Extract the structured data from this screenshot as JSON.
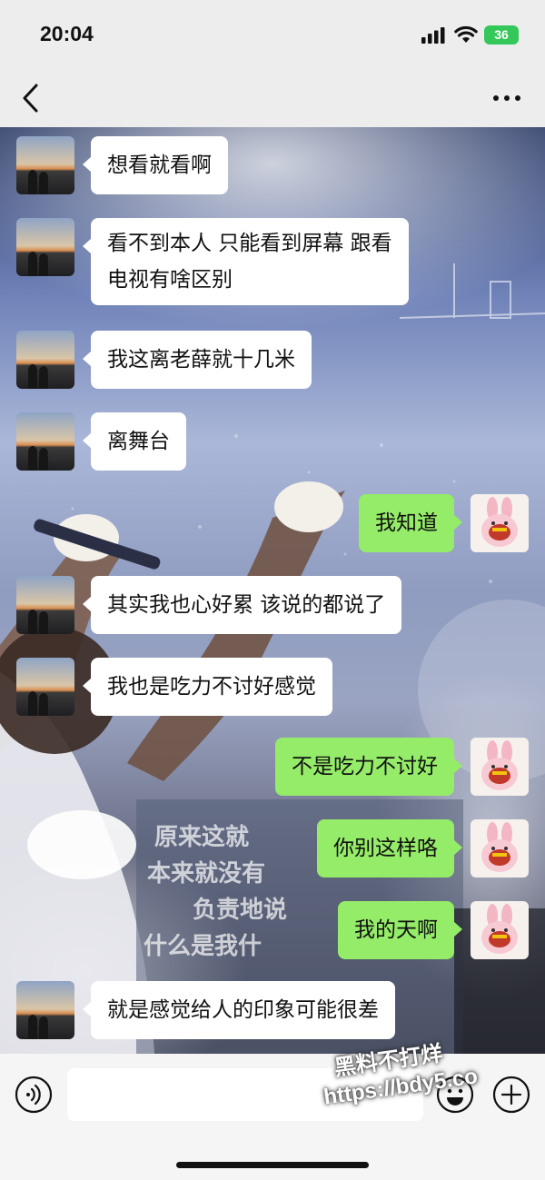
{
  "status_bar": {
    "time": "20:04",
    "battery": "36",
    "icons": [
      "signal-icon",
      "wifi-icon",
      "battery-icon"
    ]
  },
  "nav": {
    "back_icon": "chevron-left-icon",
    "more_icon": "more-dots-icon"
  },
  "messages": [
    {
      "side": "left",
      "lines": [
        "想看就看啊"
      ]
    },
    {
      "side": "left",
      "lines": [
        "看不到本人 只能看到屏幕 跟看",
        "电视有啥区别"
      ]
    },
    {
      "side": "left",
      "lines": [
        "我这离老薛就十几米"
      ]
    },
    {
      "side": "left",
      "lines": [
        "离舞台"
      ]
    },
    {
      "side": "right",
      "lines": [
        "我知道"
      ]
    },
    {
      "side": "left",
      "lines": [
        "其实我也心好累 该说的都说了"
      ]
    },
    {
      "side": "left",
      "lines": [
        "我也是吃力不讨好感觉"
      ]
    },
    {
      "side": "right",
      "lines": [
        "不是吃力不讨好"
      ]
    },
    {
      "side": "right",
      "lines": [
        "你别这样咯"
      ]
    },
    {
      "side": "right",
      "lines": [
        "我的天啊"
      ]
    },
    {
      "side": "left",
      "lines": [
        "就是感觉给人的印象可能很差"
      ]
    }
  ],
  "background_text": {
    "lines": [
      "原来这就",
      "本来就没有",
      "负责地说",
      "什么是我什"
    ]
  },
  "input_bar": {
    "voice_icon": "voice-icon",
    "emoji_icon": "emoji-icon",
    "plus_icon": "plus-icon",
    "value": ""
  },
  "watermark": {
    "line1": "黑料不打烊",
    "line2": "https://bdy5.co"
  },
  "colors": {
    "bubble_left": "#ffffff",
    "bubble_right": "#95ec69",
    "battery": "#34c759"
  }
}
